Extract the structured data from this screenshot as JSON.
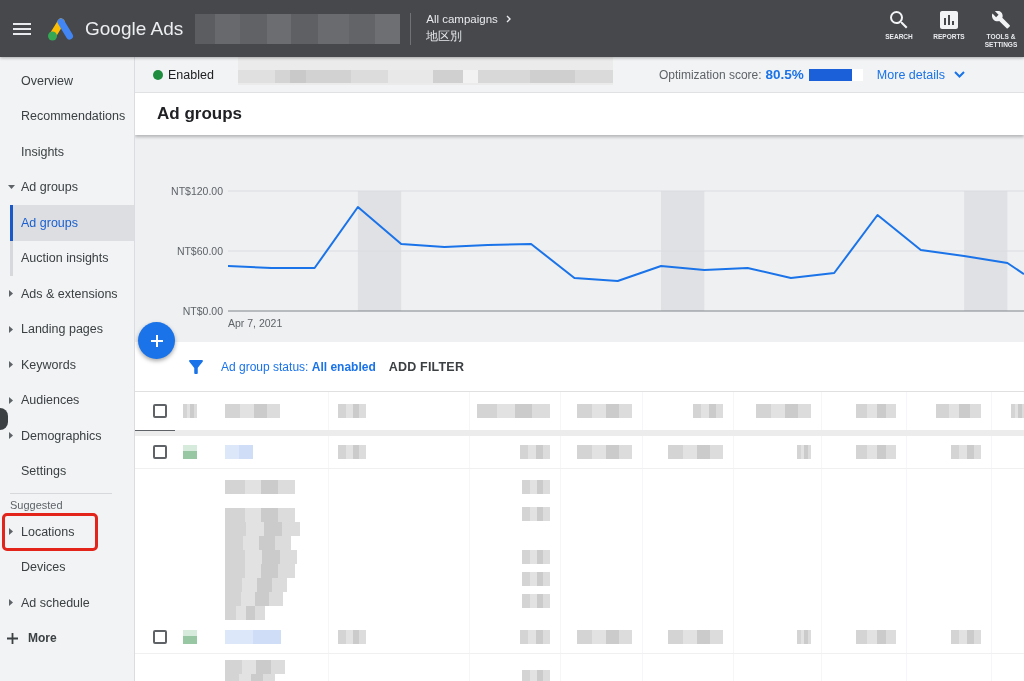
{
  "top_bar": {
    "app_name": "Google Ads",
    "breadcrumb": {
      "parent": "All campaigns",
      "current": "地区別"
    },
    "actions": [
      {
        "kind": "search",
        "label": "SEARCH"
      },
      {
        "kind": "reports",
        "label": "REPORTS"
      },
      {
        "kind": "tools",
        "label": "TOOLS & SETTINGS"
      }
    ]
  },
  "sidebar": {
    "items": [
      {
        "kind": "page",
        "label": "Overview",
        "selected": false,
        "highlighted": false
      },
      {
        "kind": "page",
        "label": "Recommendations",
        "selected": false,
        "highlighted": false
      },
      {
        "kind": "page",
        "label": "Insights",
        "selected": false,
        "highlighted": false
      },
      {
        "kind": "group",
        "label": "Ad groups",
        "expanded": true,
        "selected": false,
        "highlighted": false,
        "children": [
          {
            "label": "Ad groups",
            "selected": true,
            "highlighted": false
          },
          {
            "label": "Auction insights",
            "selected": false,
            "highlighted": false
          }
        ]
      },
      {
        "kind": "group",
        "label": "Ads & extensions",
        "expanded": false,
        "selected": false,
        "highlighted": false
      },
      {
        "kind": "group",
        "label": "Landing pages",
        "expanded": false,
        "selected": false,
        "highlighted": false
      },
      {
        "kind": "group",
        "label": "Keywords",
        "expanded": false,
        "selected": false,
        "highlighted": false
      },
      {
        "kind": "group",
        "label": "Audiences",
        "expanded": false,
        "selected": false,
        "highlighted": false
      },
      {
        "kind": "group",
        "label": "Demographics",
        "expanded": false,
        "selected": false,
        "highlighted": false
      },
      {
        "kind": "page",
        "label": "Settings",
        "selected": false,
        "highlighted": false
      }
    ],
    "suggested": {
      "heading": "Suggested",
      "items": [
        {
          "kind": "group",
          "label": "Locations",
          "expanded": false,
          "selected": false,
          "highlighted": true
        },
        {
          "kind": "page",
          "label": "Devices",
          "selected": false,
          "highlighted": false
        },
        {
          "kind": "group",
          "label": "Ad schedule",
          "expanded": false,
          "selected": false,
          "highlighted": false
        }
      ]
    },
    "more": {
      "label": "More"
    }
  },
  "status_strip": {
    "status": {
      "label": "Enabled",
      "color": "#1e8e3e"
    },
    "optimization": {
      "label": "Optimization score:",
      "value": "80.5%",
      "level": 0.805
    },
    "more_details": "More details"
  },
  "page_title": "Ad groups",
  "chart_panel": {
    "y_axis_labels": [
      "NT$120.00",
      "NT$60.00",
      "NT$0.00"
    ],
    "start_date_label": "Apr 7, 2021"
  },
  "filter_bar": {
    "filter": "Ad group status: **All enabled**",
    "add_filter": "ADD FILTER"
  },
  "table": {
    "select_all": {
      "checked": false
    },
    "rows": [
      {
        "checked": false
      },
      {
        "checked": false
      }
    ]
  }
}
